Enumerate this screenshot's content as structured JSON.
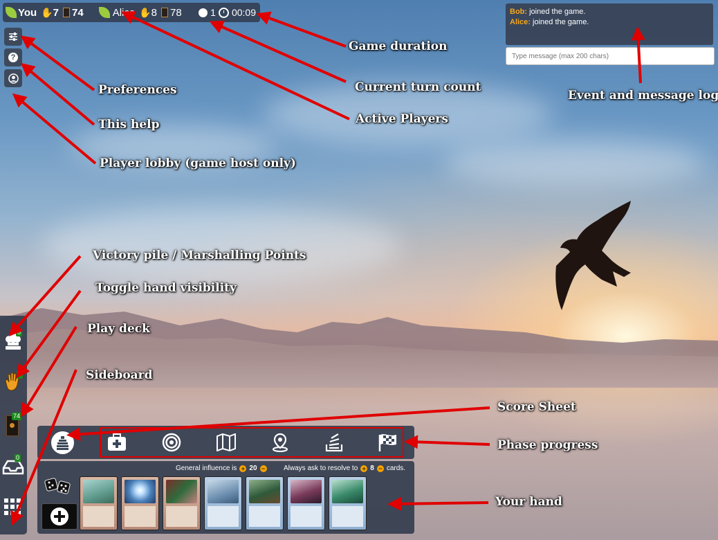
{
  "top_bar": {
    "players": [
      {
        "name": "You",
        "hand": "7",
        "deck": "74"
      },
      {
        "name": "Alice",
        "hand": "8",
        "deck": "78"
      }
    ],
    "turn": "1",
    "duration": "00:09"
  },
  "left_buttons": [
    {
      "icon": "sliders-icon"
    },
    {
      "icon": "question-icon"
    },
    {
      "icon": "user-icon"
    }
  ],
  "log": {
    "entries": [
      {
        "who": "Bob:",
        "text": "joined the game."
      },
      {
        "who": "Alice:",
        "text": "joined the game."
      }
    ],
    "placeholder": "Type message (max 200 chars)"
  },
  "left_panel": {
    "victory_count": "0",
    "hand_count": "7",
    "deck_count": "74",
    "sideboard_count": "0"
  },
  "hand_info": {
    "influence_text": "General influence is",
    "influence_value": "20",
    "ask_text": "Always ask to resolve to",
    "ask_value": "8",
    "ask_suffix": "cards.",
    "plus": "+",
    "minus": "−"
  },
  "annotations": {
    "game_duration": "Game duration",
    "turn_count": "Current turn count",
    "active_players": "Active Players",
    "preferences": "Preferences",
    "help": "This help",
    "lobby": "Player lobby (game host only)",
    "event_log": "Event and message log",
    "victory": "Victory pile / Marshalling Points",
    "toggle_hand": "Toggle hand visibility",
    "play_deck": "Play deck",
    "sideboard": "Sideboard",
    "score_sheet": "Score Sheet",
    "phase_progress": "Phase progress",
    "your_hand": "Your hand"
  },
  "colors": {
    "accent_orange": "#f7a81b",
    "annotation_arrow": "#e00000",
    "panel": "#323c4e"
  }
}
